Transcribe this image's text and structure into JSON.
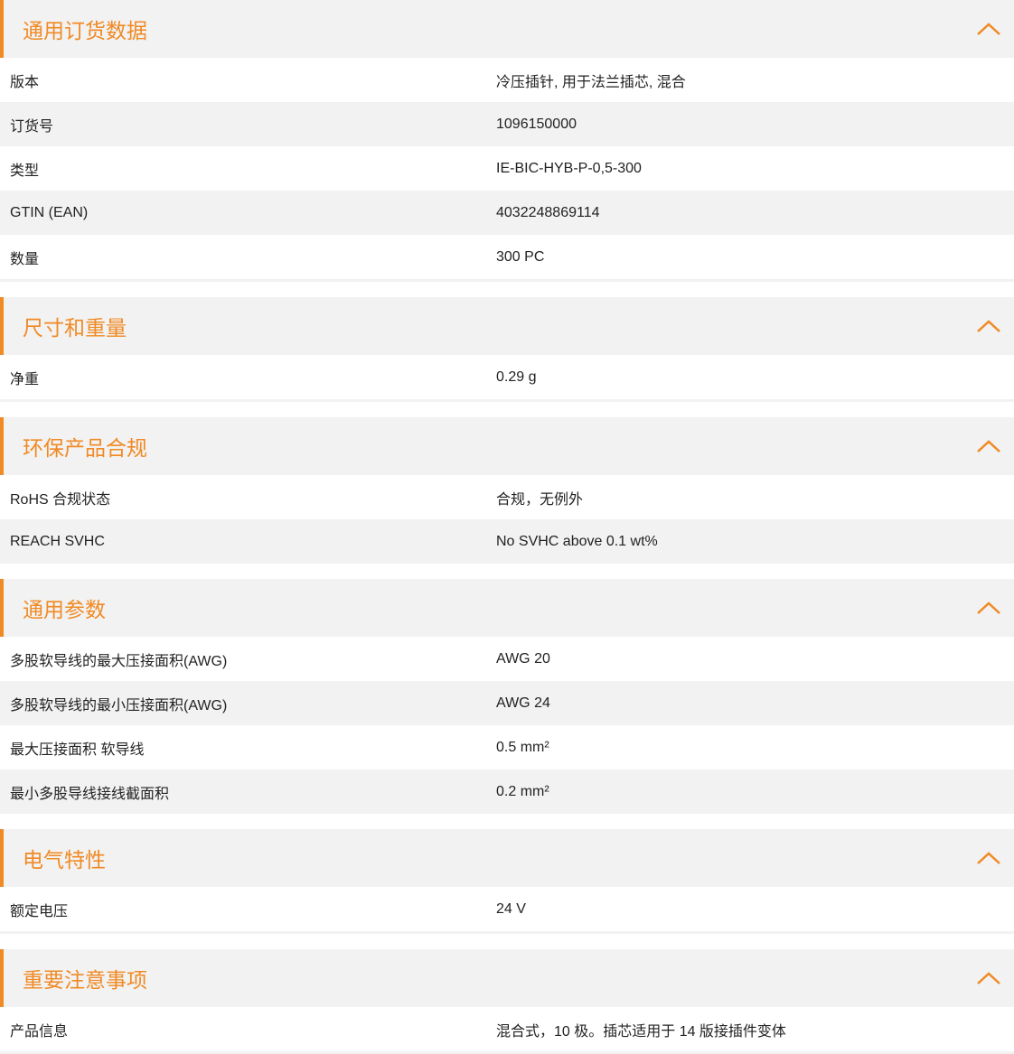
{
  "sections": [
    {
      "title": "通用订货数据",
      "rows": [
        {
          "label": "版本",
          "value": "冷压插针, 用于法兰插芯, 混合"
        },
        {
          "label": "订货号",
          "value": "1096150000"
        },
        {
          "label": "类型",
          "value": "IE-BIC-HYB-P-0,5-300"
        },
        {
          "label": "GTIN (EAN)",
          "value": "4032248869114"
        },
        {
          "label": "数量",
          "value": "300  PC"
        }
      ]
    },
    {
      "title": "尺寸和重量",
      "rows": [
        {
          "label": "净重",
          "value": "0.29  g"
        }
      ]
    },
    {
      "title": "环保产品合规",
      "rows": [
        {
          "label": "RoHS 合规状态",
          "value": "合规，无例外"
        },
        {
          "label": "REACH SVHC",
          "value": "No SVHC above 0.1 wt%"
        }
      ]
    },
    {
      "title": "通用参数",
      "rows": [
        {
          "label": "多股软导线的最大压接面积(AWG)",
          "value": "AWG 20"
        },
        {
          "label": "多股软导线的最小压接面积(AWG)",
          "value": "AWG 24"
        },
        {
          "label": "最大压接面积 软导线",
          "value": "0.5  mm²"
        },
        {
          "label": "最小多股导线接线截面积",
          "value": "0.2  mm²"
        }
      ]
    },
    {
      "title": "电气特性",
      "rows": [
        {
          "label": "额定电压",
          "value": "24  V"
        }
      ]
    },
    {
      "title": "重要注意事项",
      "rows": [
        {
          "label": "产品信息",
          "value": "混合式，10 极。插芯适用于 14 版接插件变体"
        }
      ]
    }
  ],
  "icons": {
    "collapse": "chevron-up-icon"
  },
  "colors": {
    "accent": "#f08a24",
    "stripe": "#f2f2f2",
    "text": "#222222"
  }
}
